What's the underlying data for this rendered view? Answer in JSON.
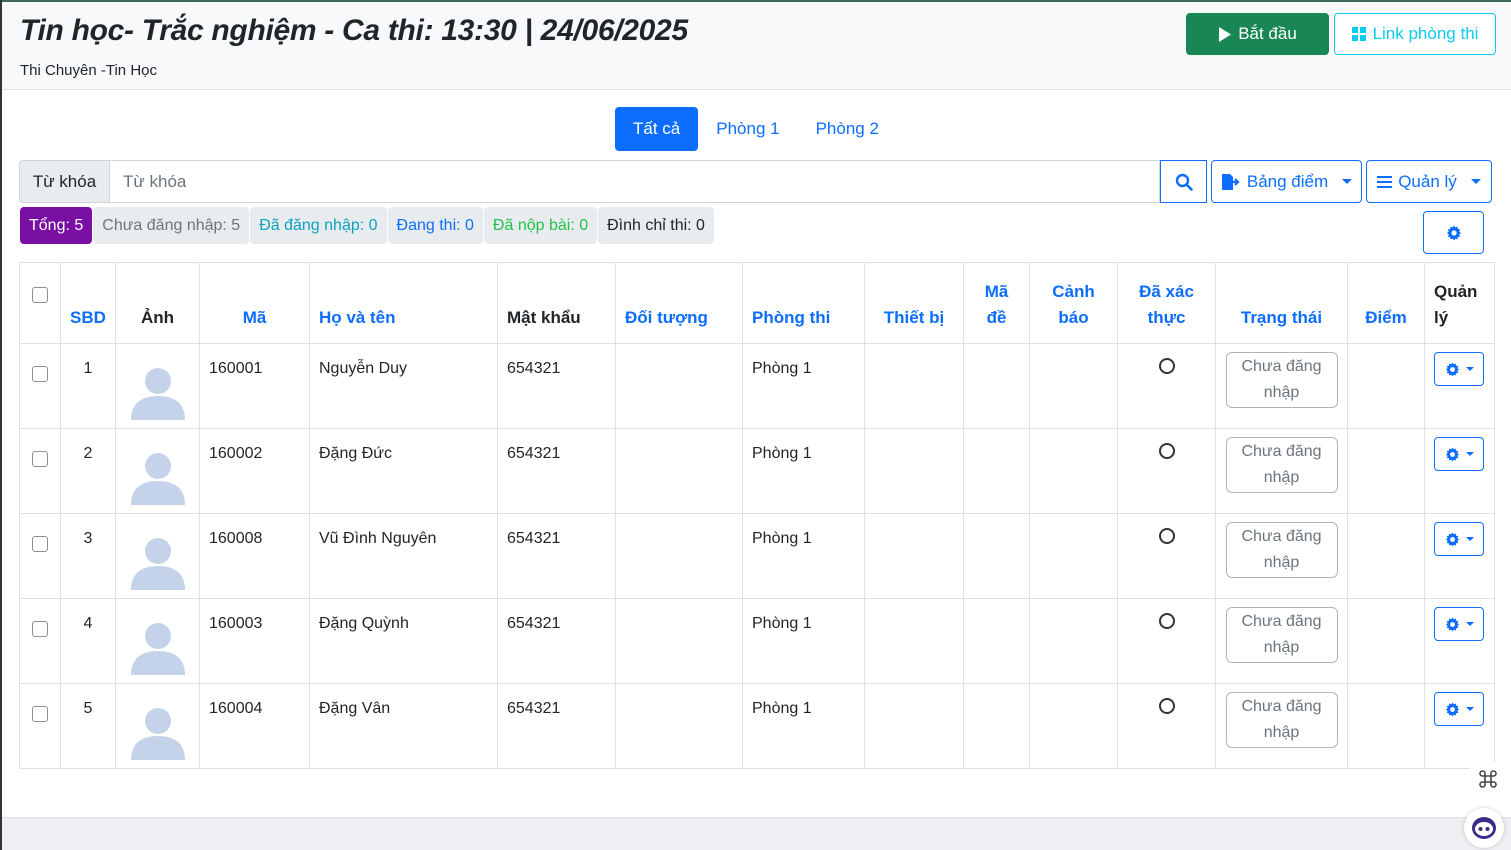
{
  "header": {
    "title": "Tin học- Trắc nghiệm - Ca thi: 13:30 | 24/06/2025",
    "subtitle": "Thi Chuyên -Tin Học",
    "start_label": "Bắt đầu",
    "link_label": "Link phòng thi"
  },
  "tabs": [
    {
      "label": "Tất cả",
      "active": true
    },
    {
      "label": "Phòng 1",
      "active": false
    },
    {
      "label": "Phòng 2",
      "active": false
    }
  ],
  "search": {
    "label": "Từ khóa",
    "placeholder": "Từ khóa",
    "value": ""
  },
  "toolbar": {
    "scoreboard_label": "Bảng điểm",
    "manage_label": "Quản lý"
  },
  "stats": [
    {
      "label": "Tổng: 5",
      "bg": "#7a0fa3",
      "color": "#ffffff"
    },
    {
      "label": "Chưa đăng nhập: 5",
      "bg": "#e9ecef",
      "color": "#6c757d"
    },
    {
      "label": "Đã đăng nhập: 0",
      "bg": "#e9ecef",
      "color": "#0aa2c0"
    },
    {
      "label": "Đang thi: 0",
      "bg": "#e9ecef",
      "color": "#0d6efd"
    },
    {
      "label": "Đã nộp bài: 0",
      "bg": "#e9ecef",
      "color": "#20c34a"
    },
    {
      "label": "Đình chỉ thi: 0",
      "bg": "#e9ecef",
      "color": "#212529"
    }
  ],
  "table": {
    "headers": {
      "sbd": "SBD",
      "photo": "Ảnh",
      "code": "Mã",
      "name": "Họ và tên",
      "password": "Mật khẩu",
      "target": "Đối tượng",
      "room": "Phòng thi",
      "device": "Thiết bị",
      "exam_code_1": "Mã",
      "exam_code_2": "đề",
      "warning_1": "Cảnh",
      "warning_2": "báo",
      "verified_1": "Đã xác",
      "verified_2": "thực",
      "status": "Trạng thái",
      "score": "Điểm",
      "manage_1": "Quản",
      "manage_2": "lý"
    },
    "rows": [
      {
        "sbd": "1",
        "code": "160001",
        "name": "Nguyễn Duy",
        "password": "654321",
        "target": "",
        "room": "Phòng 1",
        "device": "",
        "exam_code": "",
        "warning": "",
        "status_1": "Chưa đăng",
        "status_2": "nhập",
        "score": ""
      },
      {
        "sbd": "2",
        "code": "160002",
        "name": "Đặng Đức",
        "password": "654321",
        "target": "",
        "room": "Phòng 1",
        "device": "",
        "exam_code": "",
        "warning": "",
        "status_1": "Chưa đăng",
        "status_2": "nhập",
        "score": ""
      },
      {
        "sbd": "3",
        "code": "160008",
        "name": "Vũ Đình Nguyên",
        "password": "654321",
        "target": "",
        "room": "Phòng 1",
        "device": "",
        "exam_code": "",
        "warning": "",
        "status_1": "Chưa đăng",
        "status_2": "nhập",
        "score": ""
      },
      {
        "sbd": "4",
        "code": "160003",
        "name": "Đặng Quỳnh",
        "password": "654321",
        "target": "",
        "room": "Phòng 1",
        "device": "",
        "exam_code": "",
        "warning": "",
        "status_1": "Chưa đăng",
        "status_2": "nhập",
        "score": ""
      },
      {
        "sbd": "5",
        "code": "160004",
        "name": "Đặng Vân",
        "password": "654321",
        "target": "",
        "room": "Phòng 1",
        "device": "",
        "exam_code": "",
        "warning": "",
        "status_1": "Chưa đăng",
        "status_2": "nhập",
        "score": ""
      }
    ]
  },
  "icons": {
    "start": "play-icon",
    "link": "grid-icon",
    "search": "search-icon",
    "scoreboard": "export-icon",
    "manage": "menu-icon",
    "settings": "gear-icon",
    "photo": "avatar-placeholder-icon",
    "floating": "command-icon",
    "assistant": "bot-icon"
  },
  "colors": {
    "primary": "#0d6efd",
    "success": "#198754",
    "info": "#0dcaf0",
    "avatar": "#c5d3ea"
  }
}
